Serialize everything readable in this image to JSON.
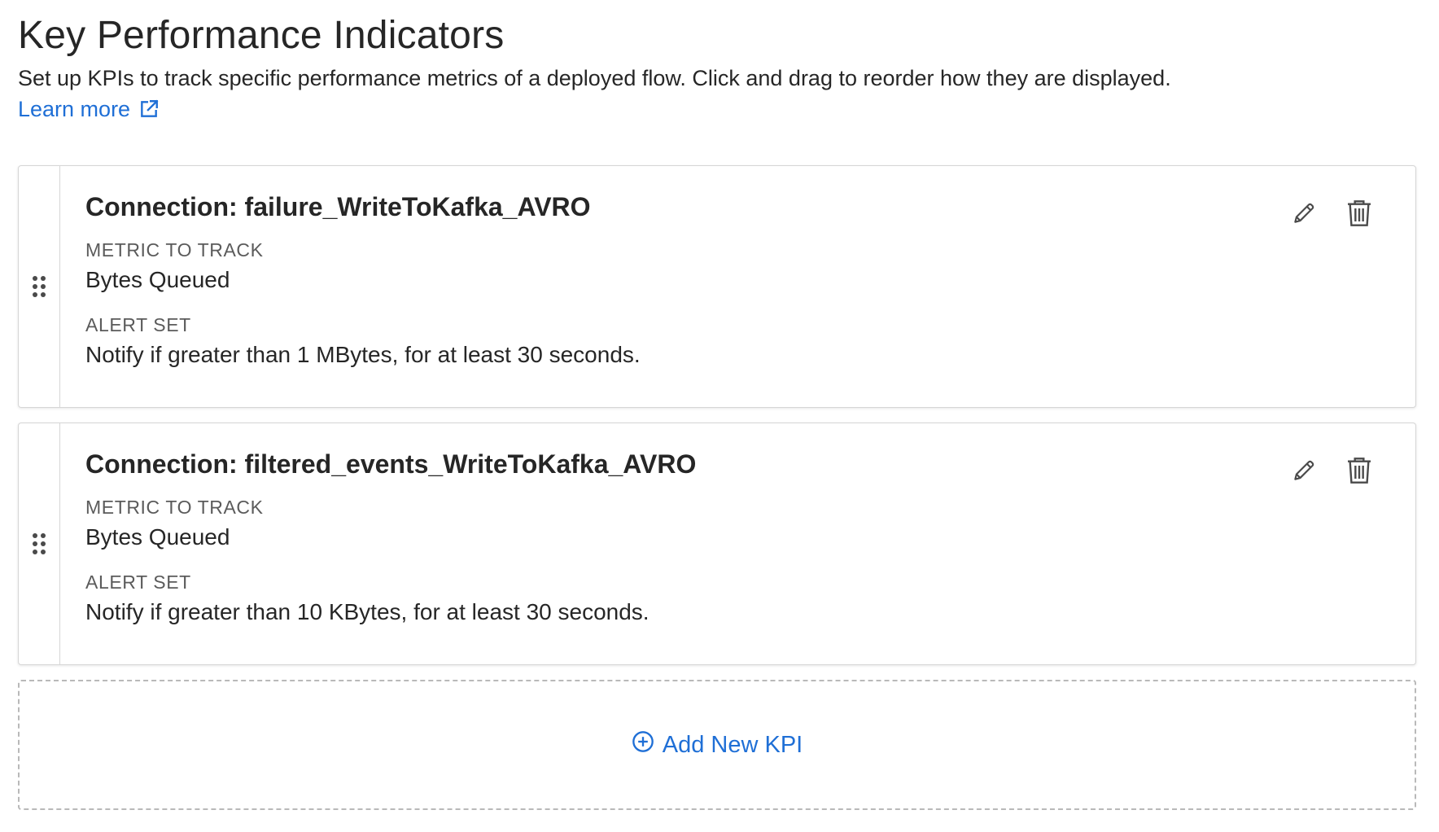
{
  "header": {
    "title": "Key Performance Indicators",
    "description": "Set up KPIs to track specific performance metrics of a deployed flow. Click and drag to reorder how they are displayed.",
    "learn_more": "Learn more"
  },
  "kpis": [
    {
      "title": "Connection: failure_WriteToKafka_AVRO",
      "metric_label": "METRIC TO TRACK",
      "metric_value": "Bytes Queued",
      "alert_label": "ALERT SET",
      "alert_value": "Notify if greater than 1 MBytes, for at least 30 seconds."
    },
    {
      "title": "Connection: filtered_events_WriteToKafka_AVRO",
      "metric_label": "METRIC TO TRACK",
      "metric_value": "Bytes Queued",
      "alert_label": "ALERT SET",
      "alert_value": "Notify if greater than 10 KBytes, for at least 30 seconds."
    }
  ],
  "add_button": {
    "label": "Add New KPI"
  },
  "icons": {
    "drag": "drag-handle-icon",
    "edit": "pencil-icon",
    "delete": "trash-icon",
    "external": "external-link-icon",
    "add": "plus-circle-icon"
  },
  "colors": {
    "link": "#1f6fd6",
    "border": "#d6d6d6",
    "icon": "#4a4a4a"
  }
}
